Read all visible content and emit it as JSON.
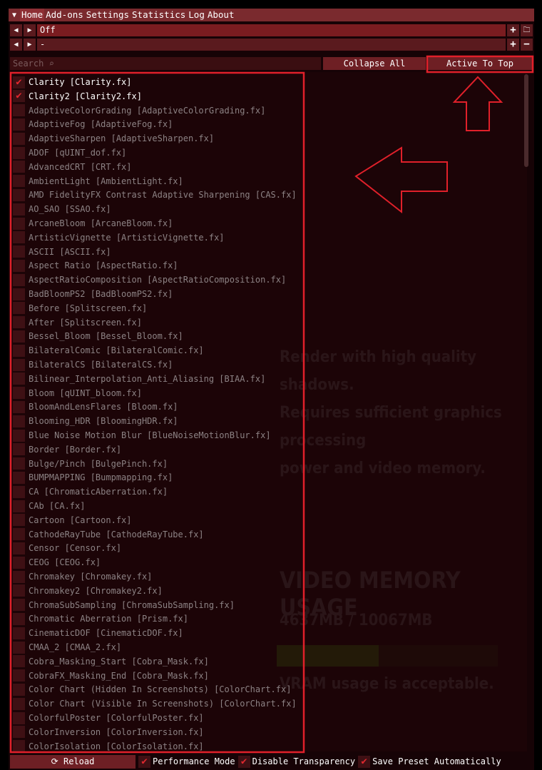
{
  "menu": {
    "tabs": [
      "Home",
      "Add-ons",
      "Settings",
      "Statistics",
      "Log",
      "About"
    ],
    "active": "Home"
  },
  "preset_row": {
    "value": "Off"
  },
  "second_row": {
    "value": "-"
  },
  "search": {
    "placeholder": "Search"
  },
  "buttons": {
    "collapse_all": "Collapse All",
    "active_to_top": "Active To Top",
    "reload": "Reload"
  },
  "effects": [
    {
      "label": "Clarity [Clarity.fx]",
      "checked": true
    },
    {
      "label": "Clarity2 [Clarity2.fx]",
      "checked": true
    },
    {
      "label": "AdaptiveColorGrading [AdaptiveColorGrading.fx]",
      "checked": false
    },
    {
      "label": "AdaptiveFog [AdaptiveFog.fx]",
      "checked": false
    },
    {
      "label": "AdaptiveSharpen [AdaptiveSharpen.fx]",
      "checked": false
    },
    {
      "label": "ADOF [qUINT_dof.fx]",
      "checked": false
    },
    {
      "label": "AdvancedCRT [CRT.fx]",
      "checked": false
    },
    {
      "label": "AmbientLight [AmbientLight.fx]",
      "checked": false
    },
    {
      "label": "AMD FidelityFX Contrast Adaptive Sharpening [CAS.fx]",
      "checked": false
    },
    {
      "label": "AO_SAO [SSAO.fx]",
      "checked": false
    },
    {
      "label": "ArcaneBloom [ArcaneBloom.fx]",
      "checked": false
    },
    {
      "label": "ArtisticVignette [ArtisticVignette.fx]",
      "checked": false
    },
    {
      "label": "ASCII [ASCII.fx]",
      "checked": false
    },
    {
      "label": "Aspect Ratio [AspectRatio.fx]",
      "checked": false
    },
    {
      "label": "AspectRatioComposition [AspectRatioComposition.fx]",
      "checked": false
    },
    {
      "label": "BadBloomPS2 [BadBloomPS2.fx]",
      "checked": false
    },
    {
      "label": "Before [Splitscreen.fx]",
      "checked": false
    },
    {
      "label": "After [Splitscreen.fx]",
      "checked": false
    },
    {
      "label": "Bessel_Bloom [Bessel_Bloom.fx]",
      "checked": false
    },
    {
      "label": "BilateralComic [BilateralComic.fx]",
      "checked": false
    },
    {
      "label": "BilateralCS [BilateralCS.fx]",
      "checked": false
    },
    {
      "label": "Bilinear_Interpolation_Anti_Aliasing [BIAA.fx]",
      "checked": false
    },
    {
      "label": "Bloom [qUINT_bloom.fx]",
      "checked": false
    },
    {
      "label": "BloomAndLensFlares [Bloom.fx]",
      "checked": false
    },
    {
      "label": "Blooming_HDR [BloomingHDR.fx]",
      "checked": false
    },
    {
      "label": "Blue Noise Motion Blur [BlueNoiseMotionBlur.fx]",
      "checked": false
    },
    {
      "label": "Border [Border.fx]",
      "checked": false
    },
    {
      "label": "Bulge/Pinch [BulgePinch.fx]",
      "checked": false
    },
    {
      "label": "BUMPMAPPING [Bumpmapping.fx]",
      "checked": false
    },
    {
      "label": "CA [ChromaticAberration.fx]",
      "checked": false
    },
    {
      "label": "CAb [CA.fx]",
      "checked": false
    },
    {
      "label": "Cartoon [Cartoon.fx]",
      "checked": false
    },
    {
      "label": "CathodeRayTube [CathodeRayTube.fx]",
      "checked": false
    },
    {
      "label": "Censor [Censor.fx]",
      "checked": false
    },
    {
      "label": "CEOG [CEOG.fx]",
      "checked": false
    },
    {
      "label": "Chromakey [Chromakey.fx]",
      "checked": false
    },
    {
      "label": "Chromakey2 [Chromakey2.fx]",
      "checked": false
    },
    {
      "label": "ChromaSubSampling [ChromaSubSampling.fx]",
      "checked": false
    },
    {
      "label": "Chromatic Aberration [Prism.fx]",
      "checked": false
    },
    {
      "label": "CinematicDOF [CinematicDOF.fx]",
      "checked": false
    },
    {
      "label": "CMAA_2 [CMAA_2.fx]",
      "checked": false
    },
    {
      "label": "Cobra_Masking_Start [Cobra_Mask.fx]",
      "checked": false
    },
    {
      "label": "CobraFX_Masking_End [Cobra_Mask.fx]",
      "checked": false
    },
    {
      "label": "Color Chart (Hidden In Screenshots) [ColorChart.fx]",
      "checked": false
    },
    {
      "label": "Color Chart (Visible In Screenshots) [ColorChart.fx]",
      "checked": false
    },
    {
      "label": "ColorfulPoster [ColorfulPoster.fx]",
      "checked": false
    },
    {
      "label": "ColorInversion [ColorInversion.fx]",
      "checked": false
    },
    {
      "label": "ColorIsolation [ColorIsolation.fx]",
      "checked": false
    }
  ],
  "options": [
    {
      "label": "Performance Mode",
      "checked": true
    },
    {
      "label": "Disable Transparency",
      "checked": true
    },
    {
      "label": "Save Preset Automatically",
      "checked": true
    }
  ],
  "background": {
    "desc_lines": [
      "Render with high quality shadows.",
      "Requires sufficient graphics processing",
      "power and video memory."
    ],
    "vram_title": "VIDEO MEMORY USAGE",
    "vram_value": "4637MB / 10067MB",
    "vram_fraction": 0.46,
    "vram_status": "VRAM usage is acceptable."
  },
  "colors": {
    "accent": "#e0282e",
    "title": "#7a2a2e",
    "annotation": "#e0202a"
  }
}
